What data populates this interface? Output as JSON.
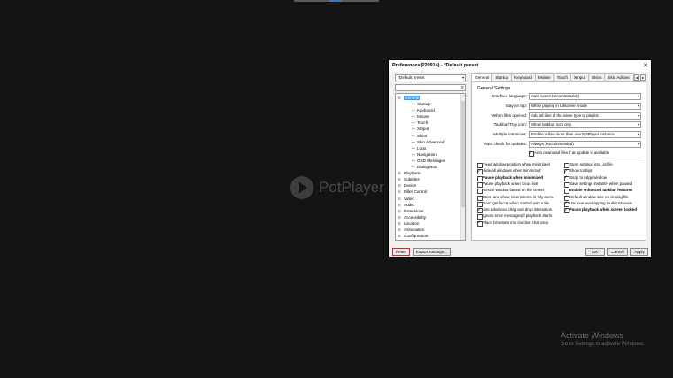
{
  "dialog": {
    "title": "Preferences(220914) - *Default preset",
    "preset": "*Default preset",
    "tree": [
      {
        "label": "General",
        "level": 0,
        "selected": true
      },
      {
        "label": "Startup",
        "level": 1
      },
      {
        "label": "Keyboard",
        "level": 1
      },
      {
        "label": "Mouse",
        "level": 1
      },
      {
        "label": "Touch",
        "level": 1
      },
      {
        "label": "XInput",
        "level": 1
      },
      {
        "label": "Skins",
        "level": 1
      },
      {
        "label": "Skin Advanced",
        "level": 1
      },
      {
        "label": "Logo",
        "level": 1
      },
      {
        "label": "Navigation",
        "level": 1
      },
      {
        "label": "OSD Messages",
        "level": 1
      },
      {
        "label": "Dialog Box",
        "level": 1
      },
      {
        "label": "Playback",
        "level": 0
      },
      {
        "label": "Subtitles",
        "level": 0
      },
      {
        "label": "Device",
        "level": 0
      },
      {
        "label": "Filter Control",
        "level": 0
      },
      {
        "label": "Video",
        "level": 0
      },
      {
        "label": "Audio",
        "level": 0
      },
      {
        "label": "Extensions",
        "level": 0
      },
      {
        "label": "Accessibility",
        "level": 0
      },
      {
        "label": "Location",
        "level": 0
      },
      {
        "label": "Association",
        "level": 0
      },
      {
        "label": "Configuration",
        "level": 0
      }
    ],
    "tabs": [
      "General",
      "Startup",
      "Keyboard",
      "Mouse",
      "Touch",
      "XInput",
      "Skins",
      "Skin Advanc"
    ],
    "group_title": "General Settings",
    "rows": [
      {
        "label": "Interface language:",
        "value": "Auto select (recommended)"
      },
      {
        "label": "Stay on top:",
        "value": "While playing in fullscreen mode"
      },
      {
        "label": "When files opened:",
        "value": "Add all files of the same type to playlist"
      },
      {
        "label": "Taskbar/Tray icon:",
        "value": "Show taskbar icon only"
      },
      {
        "label": "Multiple instances:",
        "value": "Enable: Allow more than one PotPlayer instance"
      },
      {
        "label": "Auto check for updates:",
        "value": "Always (Recommended)"
      }
    ],
    "auto_download": "Auto download files if an update is available",
    "left_checks": [
      {
        "label": "Fixed window position when minimized",
        "on": false,
        "bold": false
      },
      {
        "label": "Hide all windows when minimized",
        "on": true,
        "bold": false
      },
      {
        "label": "Pause playback when minimized",
        "on": false,
        "bold": true
      },
      {
        "label": "Pause playback when focus lost",
        "on": false,
        "bold": false
      },
      {
        "label": "Resize window based on the center",
        "on": false,
        "bold": false
      },
      {
        "label": "Store and show recent items in 'My menu",
        "on": false,
        "bold": false
      },
      {
        "label": "Don't get focus when started with a file",
        "on": false,
        "bold": false
      },
      {
        "label": "Use advanced drag and drop interaction",
        "on": true,
        "bold": false
      },
      {
        "label": "Ignore error messages if playback starts",
        "on": false,
        "bold": false
      },
      {
        "label": "Place browsers into inactive chat area",
        "on": true,
        "bold": false
      }
    ],
    "right_checks": [
      {
        "label": "Store settings into .ini file",
        "on": false,
        "bold": false
      },
      {
        "label": "Show tooltips",
        "on": true,
        "bold": false
      },
      {
        "label": "Snap to edge/window",
        "on": true,
        "bold": false
      },
      {
        "label": "Save settings instantly when paused",
        "on": false,
        "bold": false
      },
      {
        "label": "Enable enhanced taskbar features",
        "on": false,
        "bold": true
      },
      {
        "label": "Default window size on closing file",
        "on": true,
        "bold": false
      },
      {
        "label": "Use non-overlapping multi instances",
        "on": true,
        "bold": false
      },
      {
        "label": "Pause playback when screen locked",
        "on": true,
        "bold": true
      }
    ],
    "buttons": {
      "reset": "Reset",
      "export": "Export Settings...",
      "ok": "OK",
      "cancel": "Cancel",
      "apply": "Apply"
    }
  },
  "background": {
    "logo_text": "PotPlayer",
    "activate_title": "Activate Windows",
    "activate_sub": "Go to Settings to activate Windows."
  },
  "colors": {
    "highlight": "#e0202a",
    "selection": "#3399ff"
  }
}
